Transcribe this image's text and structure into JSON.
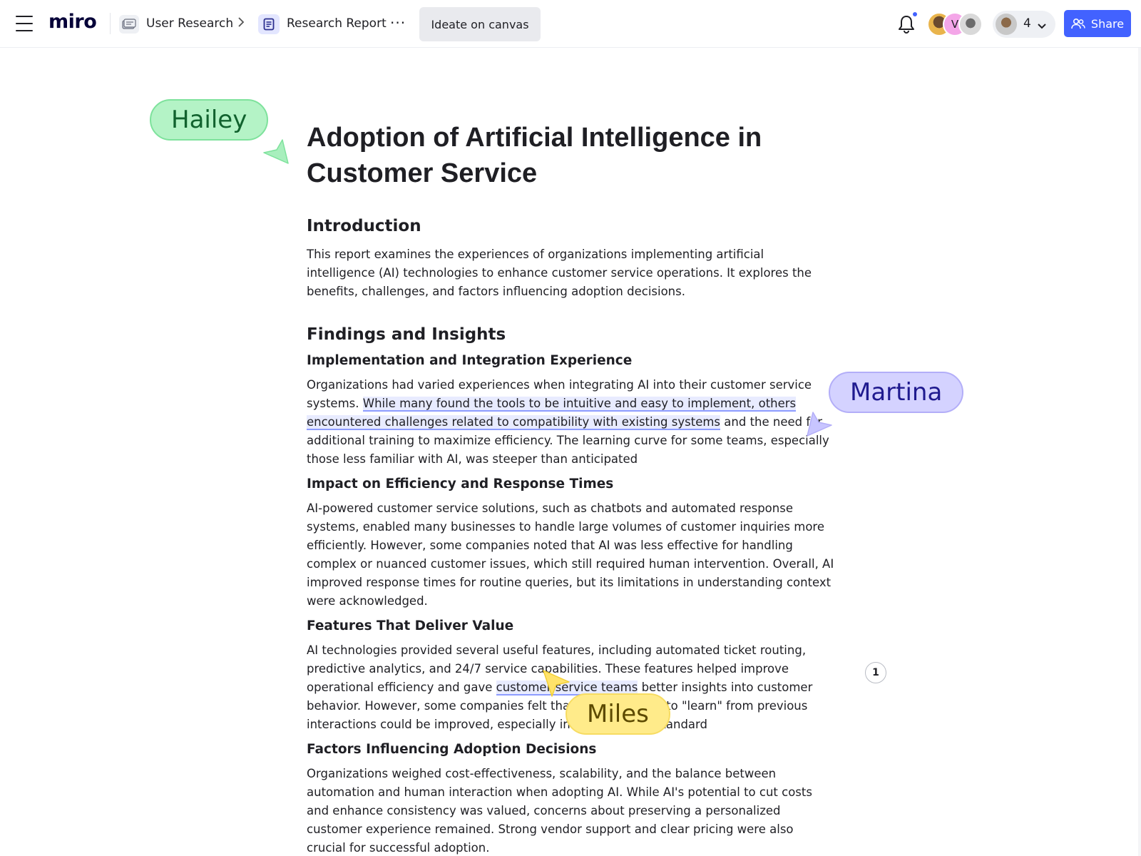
{
  "header": {
    "logo": "miro",
    "breadcrumb": [
      {
        "label": "User Research",
        "icon": "board-icon"
      },
      {
        "label": "Research Report",
        "icon": "document-icon"
      }
    ],
    "more_label": "···",
    "ideate_label": "Ideate on canvas",
    "avatar_initial": "V",
    "user_count": "4",
    "share_label": "Share",
    "accent_color": "#4262ff"
  },
  "document": {
    "title": "Adoption of Artificial Intelligence in Customer Service",
    "intro_heading": "Introduction",
    "intro_text": "This report examines the experiences of organizations implementing artificial intelligence (AI) technologies to enhance customer service operations. It explores the benefits, challenges, and factors influencing adoption decisions.",
    "findings_heading": "Findings and Insights",
    "sections": [
      {
        "heading": "Implementation and Integration Experience",
        "text_before": "Organizations had varied experiences when integrating AI into their customer service systems. ",
        "text_highlight": "While many found the tools to be intuitive and easy to implement, others encountered challenges related to compatibility with existing systems",
        "text_after": " and the need for additional training to maximize efficiency. The learning curve for some teams, especially those less familiar with AI, was steeper than anticipated"
      },
      {
        "heading": "Impact on Efficiency and Response Times",
        "text": "AI-powered customer service solutions, such as chatbots and automated response systems, enabled many businesses to handle large volumes of customer inquiries more efficiently. However, some companies noted that AI was less effective for handling complex or nuanced customer issues, which still required human intervention. Overall, AI improved response times for routine queries, but its limitations in understanding context were acknowledged."
      },
      {
        "heading": "Features That Deliver Value",
        "text_before": "AI technologies provided several useful features, including automated ticket routing, predictive analytics, and 24/7 service capabilities. These features helped improve operational efficiency and gave ",
        "text_highlight": "customer service teams",
        "text_after": " better insights into customer behavior. However, some companies felt that the AI’s ability to \"learn\" from previous interactions could be improved, especially in handling non-standard"
      },
      {
        "heading": "Factors Influencing Adoption Decisions",
        "text": "Organizations weighed cost-effectiveness, scalability, and the balance between automation and human interaction when adopting AI. While AI's potential to cut costs and enhance consistency was valued, concerns about preserving a personalized customer experience remained. Strong vendor support and clear pricing were also crucial for successful adoption."
      }
    ]
  },
  "collaborators": [
    {
      "name": "Hailey",
      "color": "#b4f3c6"
    },
    {
      "name": "Martina",
      "color": "#d4d2ff"
    },
    {
      "name": "Miles",
      "color": "#ffeb8a"
    }
  ],
  "comment_count": "1"
}
